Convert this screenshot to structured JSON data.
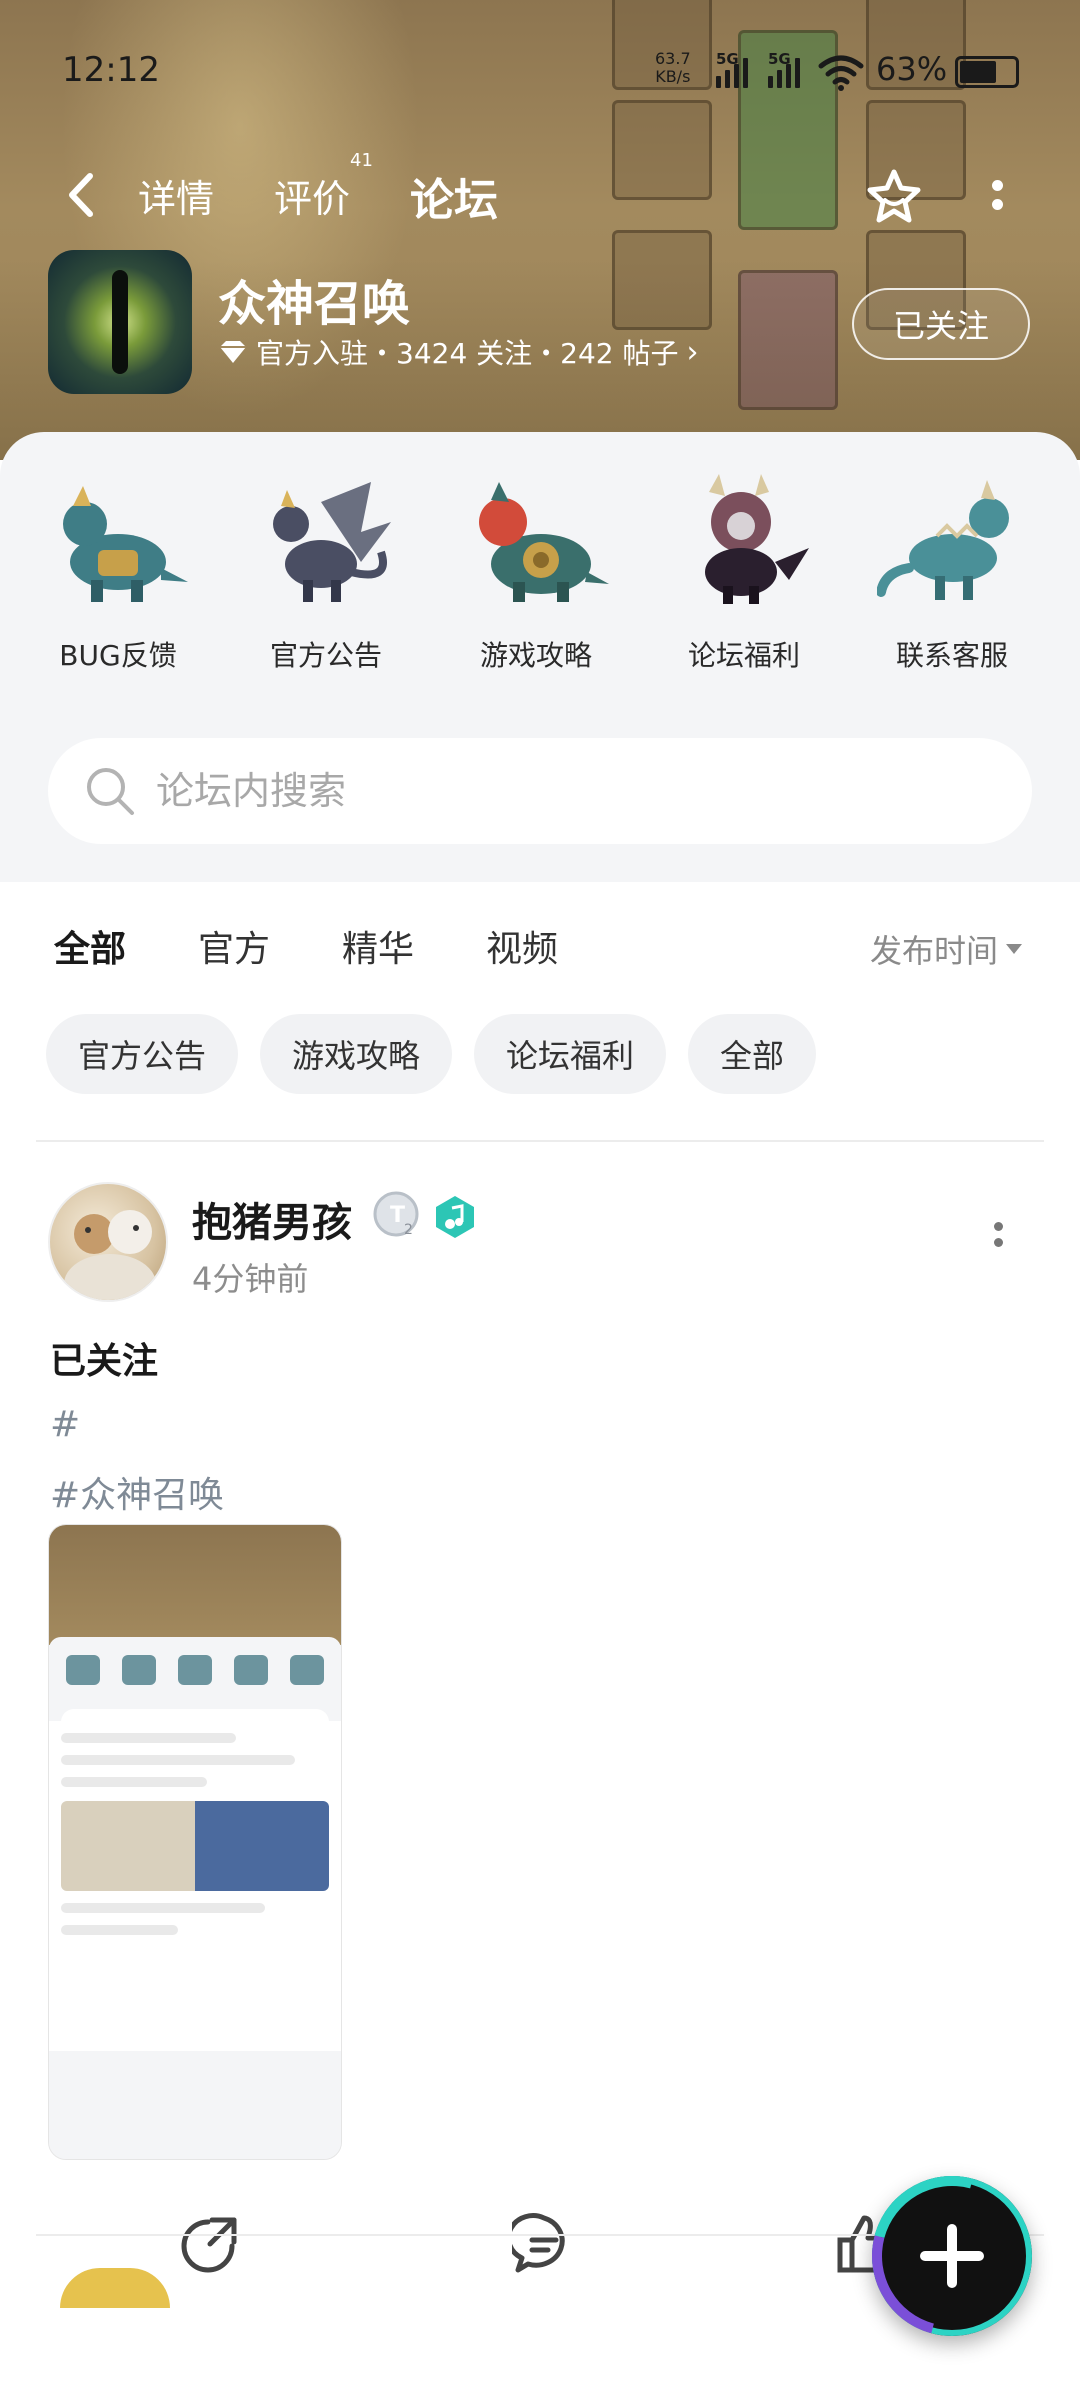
{
  "status_bar": {
    "time": "12:12",
    "speed_value": "63.7",
    "speed_unit": "KB/s",
    "network_1": "5G",
    "network_2": "5G",
    "battery": "63%"
  },
  "nav": {
    "tabs": [
      {
        "label": "详情",
        "active": false
      },
      {
        "label": "评价",
        "active": false,
        "badge": "41"
      },
      {
        "label": "论坛",
        "active": true
      }
    ]
  },
  "game": {
    "title": "众神召唤",
    "meta": "官方入驻・3424 关注・242 帖子",
    "follow_label": "已关注"
  },
  "quick_links": [
    {
      "label": "BUG反馈",
      "icon": "dragon-armored-icon"
    },
    {
      "label": "官方公告",
      "icon": "dragon-winged-icon"
    },
    {
      "label": "游戏攻略",
      "icon": "dragon-shield-icon"
    },
    {
      "label": "论坛福利",
      "icon": "dragon-demon-icon"
    },
    {
      "label": "联系客服",
      "icon": "dragon-teal-icon"
    }
  ],
  "search": {
    "placeholder": "论坛内搜索"
  },
  "feed_tabs": [
    {
      "label": "全部",
      "active": true
    },
    {
      "label": "官方",
      "active": false
    },
    {
      "label": "精华",
      "active": false
    },
    {
      "label": "视频",
      "active": false
    }
  ],
  "sort_label": "发布时间",
  "chips": [
    "官方公告",
    "游戏攻略",
    "论坛福利",
    "全部"
  ],
  "post": {
    "author": "抱猪男孩",
    "level": "T2",
    "time": "4分钟前",
    "title": "已关注",
    "tags": [
      "#",
      "#众神召唤"
    ]
  },
  "colors": {
    "accent": "#2cd3c4",
    "banner": "#a38a5e",
    "fab_ring": "#7b4fd8"
  }
}
